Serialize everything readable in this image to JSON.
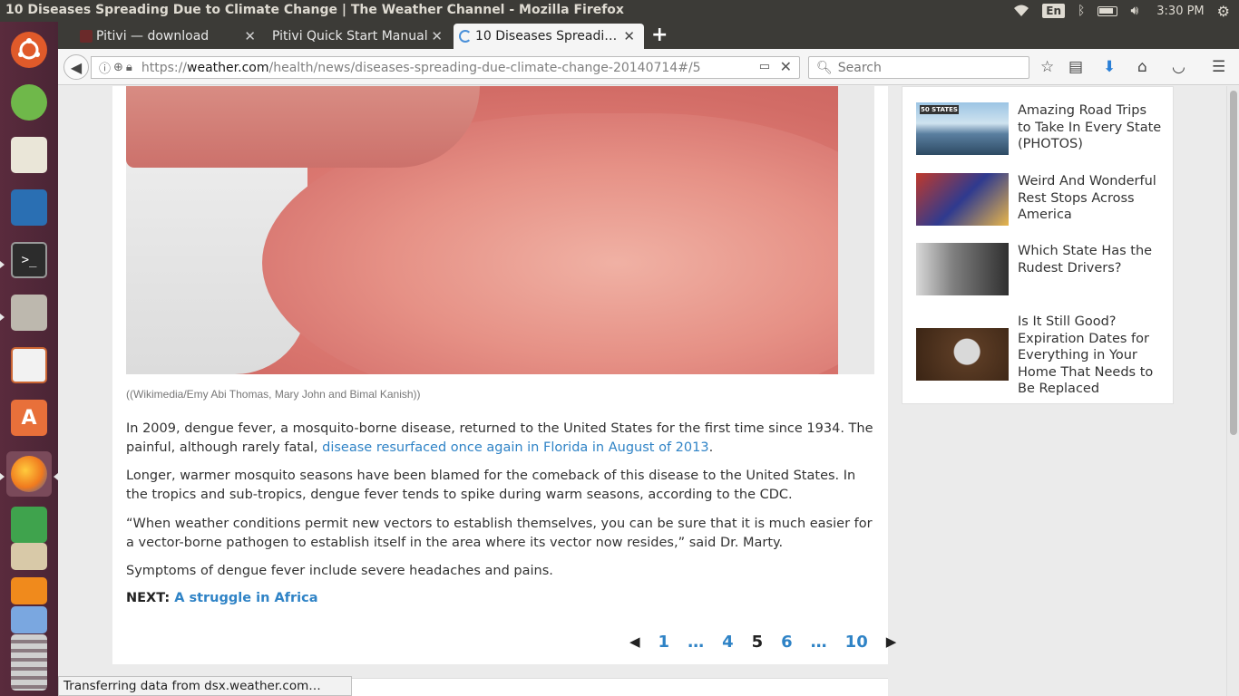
{
  "window": {
    "title": "10 Diseases Spreading Due to Climate Change | The Weather Channel - Mozilla Firefox"
  },
  "indicators": {
    "keyboard": "En",
    "time": "3:30 PM"
  },
  "tabs": [
    {
      "label": "Pitivi — download"
    },
    {
      "label": "Pitivi Quick Start Manual"
    },
    {
      "label": "10 Diseases Spreadi…"
    }
  ],
  "newtab_label": "+",
  "url": {
    "prefix": "https://",
    "host": "weather.com",
    "path": "/health/news/diseases-spreading-due-climate-change-20140714#/5"
  },
  "search": {
    "placeholder": "Search"
  },
  "article": {
    "caption": "((Wikimedia/Emy Abi Thomas, Mary John and Bimal Kanish))",
    "p1_text": "In 2009, dengue fever, a mosquito-borne disease, returned to the United States for the first time since 1934. The painful, although rarely fatal, ",
    "p1_link": "disease resurfaced once again in Florida in August of 2013",
    "p1_end": ".",
    "p2": "Longer, warmer mosquito seasons have been blamed for the comeback of this disease to the United States. In the tropics and sub-tropics, dengue fever tends to spike during warm seasons, according to the CDC.",
    "p3": "“When weather conditions permit new vectors to establish themselves, you can be sure that it is much easier for a vector-borne pathogen to establish itself in the area where its vector now resides,” said Dr. Marty.",
    "p4": "Symptoms of dengue fever include severe headaches and pains.",
    "next_label": "NEXT:",
    "next_link": "A struggle in Africa"
  },
  "pager": {
    "first": "1",
    "ellipsis1": "…",
    "p4": "4",
    "current": "5",
    "p6": "6",
    "ellipsis2": "…",
    "last": "10"
  },
  "related": [
    {
      "title": "Amazing Road Trips to Take In Every State (PHOTOS)",
      "thumb_text": "50 STATES"
    },
    {
      "title": "Weird And Wonderful Rest Stops Across America"
    },
    {
      "title": "Which State Has the Rudest Drivers?"
    },
    {
      "title": "Is It Still Good? Expiration Dates for Everything in Your Home That Needs to Be Replaced"
    }
  ],
  "status_text": "Transferring data from dsx.weather.com…",
  "colors": {
    "link": "#2f83c6",
    "panel": "#3c3b37",
    "launcher": "#4a2535"
  }
}
